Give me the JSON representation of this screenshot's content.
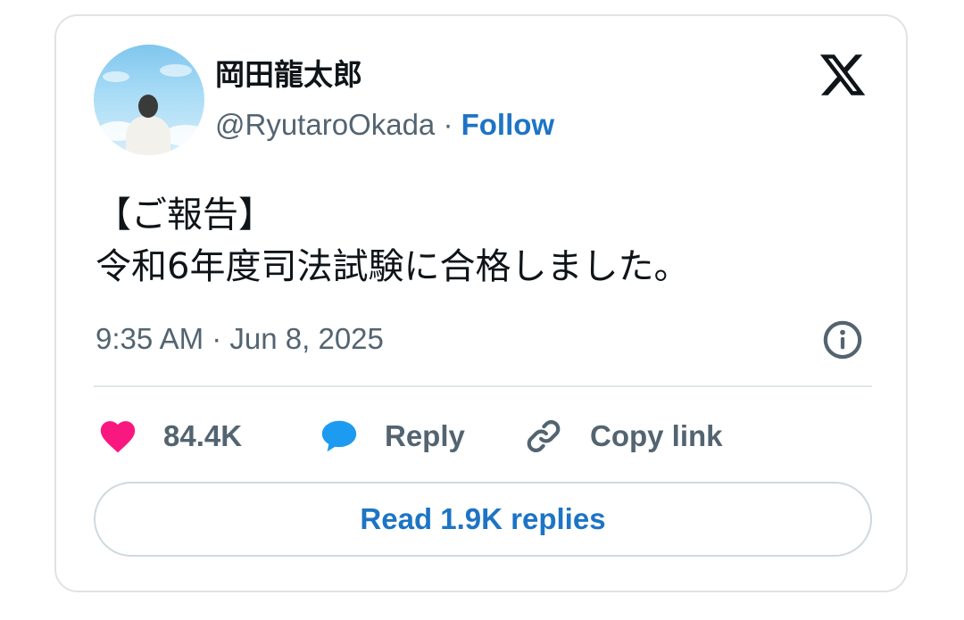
{
  "author": {
    "display_name": "岡田龍太郎",
    "handle": "@RyutaroOkada",
    "separator": " · ",
    "follow_label": "Follow",
    "avatar_icon": "avatar-photo"
  },
  "brand": {
    "logo_icon": "x-logo-icon"
  },
  "tweet": {
    "lines": [
      "【ご報告】",
      "令和6年度司法試験に合格しました。"
    ],
    "timestamp": "9:35 AM · Jun 8, 2025"
  },
  "actions": {
    "likes_count": "84.4K",
    "reply_label": "Reply",
    "copy_link_label": "Copy link"
  },
  "replies_button": {
    "label": "Read 1.9K replies"
  },
  "colors": {
    "like": "#f91880",
    "reply": "#1d9bf0",
    "link": "#1d74c5",
    "muted": "#536471",
    "text": "#0f1419"
  }
}
